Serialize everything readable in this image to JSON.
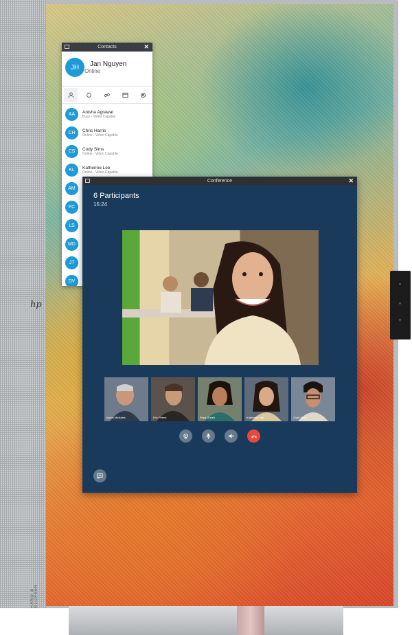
{
  "device": {
    "logo": "hp",
    "brand_label": "RANG & OLUFSEN"
  },
  "contacts_window": {
    "title": "Contacts",
    "me": {
      "initials": "JH",
      "name": "Jan Nguyen",
      "status": "Online"
    },
    "tabs": [
      {
        "icon": "person-icon"
      },
      {
        "icon": "bell-icon"
      },
      {
        "icon": "link-icon"
      },
      {
        "icon": "calendar-icon"
      },
      {
        "icon": "gear-icon"
      }
    ],
    "contacts": [
      {
        "initials": "AA",
        "name": "Anisha Agrawal",
        "status": "Busy - Video Capable"
      },
      {
        "initials": "CH",
        "name": "Chris Harris",
        "status": "Online - Video Capable"
      },
      {
        "initials": "CS",
        "name": "Cody Sims",
        "status": "Online - Video Capable"
      },
      {
        "initials": "KL",
        "name": "Katherine Lee",
        "status": "Online - Video Capable"
      },
      {
        "initials": "AM",
        "name": "",
        "status": ""
      },
      {
        "initials": "FC",
        "name": "",
        "status": ""
      },
      {
        "initials": "LS",
        "name": "",
        "status": ""
      },
      {
        "initials": "MD",
        "name": "",
        "status": ""
      },
      {
        "initials": "JT",
        "name": "",
        "status": ""
      },
      {
        "initials": "DV",
        "name": "",
        "status": ""
      }
    ],
    "avatar_color": "#1f9ad6"
  },
  "conference_window": {
    "title": "Conference",
    "participants_label": "6 Participants",
    "elapsed_time": "15:24",
    "thumbnails": [
      {
        "name": "Aaron Michaels"
      },
      {
        "name": "Eric Peters"
      },
      {
        "name": "Priya Ghosh"
      },
      {
        "name": "Katherine Lee"
      },
      {
        "name": "Cody Sims"
      }
    ],
    "controls": [
      {
        "icon": "camera-icon"
      },
      {
        "icon": "microphone-icon"
      },
      {
        "icon": "speaker-icon"
      },
      {
        "icon": "hang-up-icon"
      }
    ],
    "end_call_color": "#e74a3b"
  }
}
